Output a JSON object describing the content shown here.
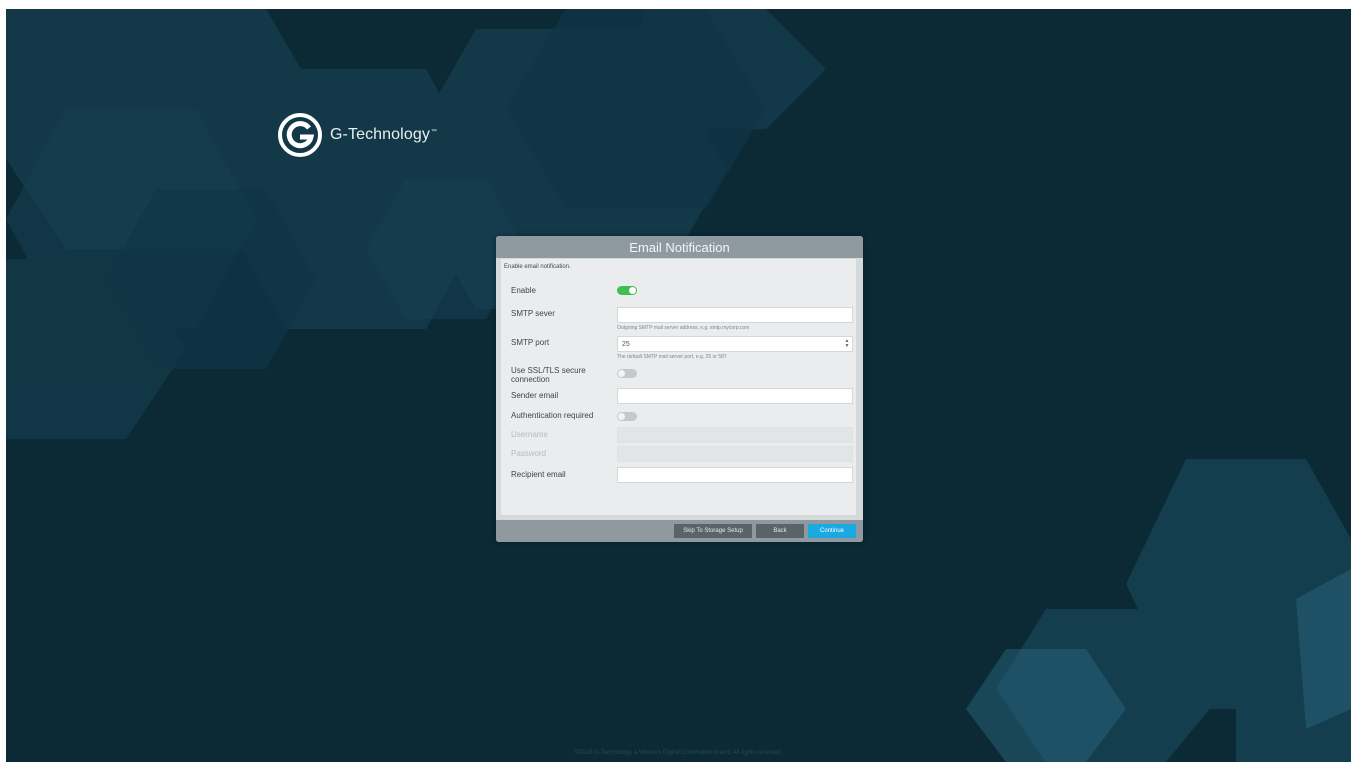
{
  "brand": {
    "logo_icon": "g-technology-logo-icon",
    "name": "G-Technology",
    "trademark": "™"
  },
  "dialog": {
    "title": "Email Notification",
    "intro": "Enable email notification.",
    "fields": {
      "enable": {
        "label": "Enable",
        "state": "on"
      },
      "smtp_server": {
        "label": "SMTP sever",
        "value": "",
        "hint": "Outgoing SMTP mail server address, e.g. smtp.mycorp.com"
      },
      "smtp_port": {
        "label": "SMTP port",
        "value": "25",
        "hint": "The default SMTP mail server port, e.g. 25 or 587"
      },
      "use_ssl": {
        "label": "Use SSL/TLS secure connection",
        "state": "off"
      },
      "sender_email": {
        "label": "Sender email",
        "value": ""
      },
      "auth_required": {
        "label": "Authentication required",
        "state": "off"
      },
      "username": {
        "label": "Username",
        "value": ""
      },
      "password": {
        "label": "Password",
        "value": ""
      },
      "recipient_email": {
        "label": "Recipient email",
        "value": ""
      }
    },
    "buttons": {
      "skip": "Skip To Storage Setup",
      "back": "Back",
      "continue": "Continue"
    }
  },
  "footer": {
    "copyright": "©2016 G-Technology, a Western Digital Corporation brand. All rights reserved."
  },
  "colors": {
    "background": "#0b2a36",
    "accent": "#1ba9e2",
    "toggle_on": "#3fbf4f"
  }
}
